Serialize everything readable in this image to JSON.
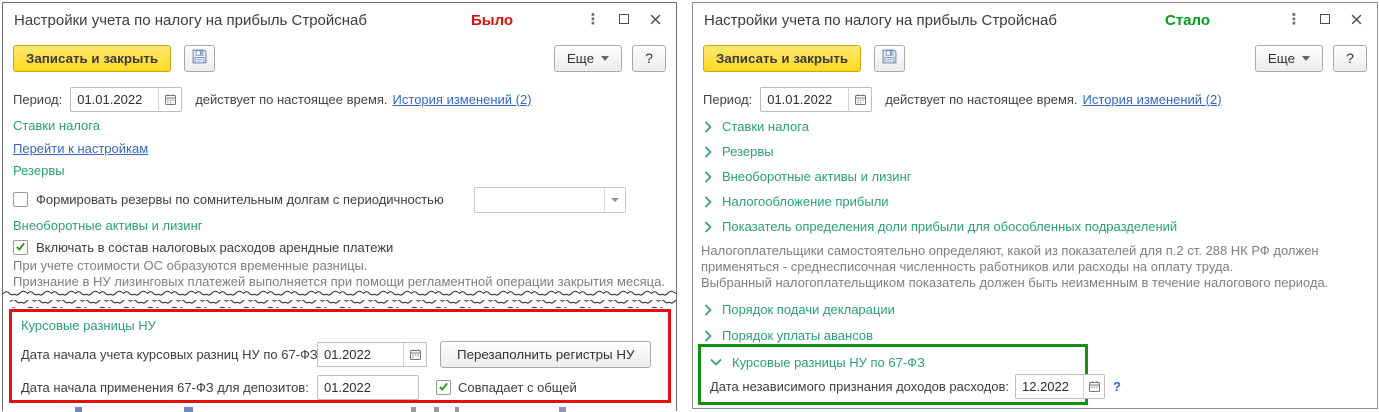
{
  "window": {
    "title": "Настройки учета по налогу на прибыль Стройснаб",
    "toolbar": {
      "save_close": "Записать и закрыть",
      "more": "Еще",
      "help": "?"
    },
    "period": {
      "label": "Период:",
      "value": "01.01.2022",
      "note": "действует по настоящее время.",
      "history_link": "История изменений (2)"
    }
  },
  "icons": {
    "window_menu": "⋮",
    "dropdown_arrow": "▾",
    "save": "floppy-disk",
    "calendar": "calendar",
    "check": "green-checkmark",
    "chevron_collapsed": "›",
    "chevron_expanded": "⌄"
  },
  "left": {
    "badge": "Было",
    "tax_rates_title": "Ставки налога",
    "tax_rates_link": "Перейти к настройкам",
    "reserves_title": "Резервы",
    "reserves_checkbox": "Формировать резервы по сомнительным долгам с периодичностью",
    "assets_title": "Внеоборотные активы и лизинг",
    "assets_checkbox": "Включать в состав налоговых расходов арендные платежи",
    "assets_note1": "При учете стоимости ОС образуются временные разницы.",
    "assets_note2": "Признание в НУ лизинговых платежей выполняется при помощи регламентной операции закрытия месяца.",
    "exchange": {
      "title": "Курсовые разницы НУ",
      "row1_label": "Дата начала учета курсовых разниц НУ по 67-ФЗ:",
      "row1_value": "01.2022",
      "row1_button": "Перезаполнить регистры НУ",
      "row2_label": "Дата начала применения 67-ФЗ для депозитов:",
      "row2_value": "01.2022",
      "row2_checkbox": "Совпадает с общей"
    }
  },
  "right": {
    "badge": "Стало",
    "groups": [
      "Ставки налога",
      "Резервы",
      "Внеоборотные активы и лизинг",
      "Налогообложение прибыли",
      "Показатель определения доли прибыли для обособленных подразделений"
    ],
    "note_lines": [
      "Налогоплательщики самостоятельно определяют, какой из показателей для п.2 ст. 288 НК РФ должен",
      "применяться - среднесписочная численность работников или расходы на оплату труда.",
      "Выбранный налогоплательщиком показатель должен быть неизменным в течение налогового периода."
    ],
    "groups2": [
      "Порядок подачи декларации",
      "Порядок уплаты авансов"
    ],
    "exchange": {
      "title": "Курсовые разницы НУ по 67-ФЗ",
      "label": "Дата независимого признания доходов расходов:",
      "value": "12.2022",
      "help": "?"
    }
  },
  "colors": {
    "primary_button": "#ffd91f",
    "section_header_green": "#2aa077",
    "badge_before": "#dd0f0f",
    "badge_after": "#00a01e",
    "highlight_before_border": "#e31010",
    "highlight_after_border": "#149114",
    "link_blue": "#3468c0",
    "note_gray": "#7f7f7f"
  }
}
